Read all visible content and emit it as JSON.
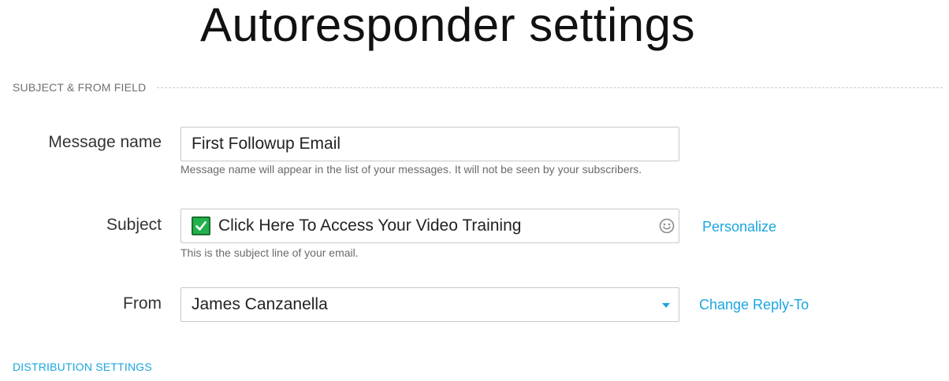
{
  "page": {
    "title": "Autoresponder settings"
  },
  "section_subject_from": {
    "label": "SUBJECT & FROM FIELD"
  },
  "message_name": {
    "label": "Message name",
    "value": "First Followup Email",
    "hint": "Message name will appear in the list of your messages. It will not be seen by your subscribers."
  },
  "subject": {
    "label": "Subject",
    "value": "Click Here To Access Your Video Training",
    "leading_icon": "check-mark-emoji",
    "trailing_icon": "smiley-icon",
    "hint": "This is the subject line of your email.",
    "personalize_link": "Personalize"
  },
  "from": {
    "label": "From",
    "selected": "James Canzanella",
    "change_reply_to_link": "Change Reply-To"
  },
  "distribution": {
    "label": "DISTRIBUTION SETTINGS"
  },
  "colors": {
    "accent": "#1aa6e0",
    "check_green": "#22b14c"
  }
}
